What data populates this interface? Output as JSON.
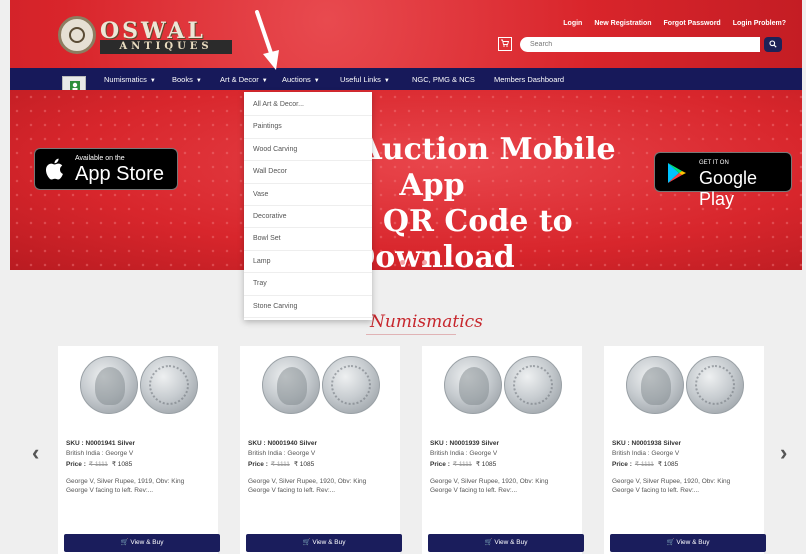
{
  "header": {
    "logo_line1": "OSWAL",
    "logo_line2": "ANTIQUES",
    "links": [
      "Login",
      "New Registration",
      "Forgot Password",
      "Login Problem?"
    ],
    "search_placeholder": "Search"
  },
  "nav": {
    "items": [
      "Numismatics",
      "Books",
      "Art & Decor",
      "Auctions",
      "Useful Links",
      "NGC, PMG & NCS",
      "Members Dashboard"
    ]
  },
  "dropdown": {
    "items": [
      "All Art & Decor...",
      "Paintings",
      "Wood Carving",
      "Wall Decor",
      "Vase",
      "Decorative",
      "Bowl Set",
      "Lamp",
      "Tray",
      "Stone Carving"
    ]
  },
  "hero": {
    "title_line1": "Oswal Auction Mobile App",
    "title_line2": "Scan QR Code to",
    "title_line3": "Download",
    "appstore_small": "Available on the",
    "appstore_big": "App Store",
    "play_small": "GET IT ON",
    "play_big": "Google Play"
  },
  "section": {
    "title": "Numismatics"
  },
  "cards": [
    {
      "sku": "SKU : N0001941",
      "metal": "Silver",
      "subtitle": "British India : George V",
      "price_label": "Price :",
      "old_price": "₹ 1111",
      "price": "₹ 1085",
      "desc1": "George V, Silver Rupee, 1919, Obv: King",
      "desc2": "George V facing to left. Rev:...",
      "button": "View & Buy"
    },
    {
      "sku": "SKU : N0001940",
      "metal": "Silver",
      "subtitle": "British India : George V",
      "price_label": "Price :",
      "old_price": "₹ 1111",
      "price": "₹ 1085",
      "desc1": "George V, Silver Rupee, 1920, Obv: King",
      "desc2": "George V facing to left. Rev:...",
      "button": "View & Buy"
    },
    {
      "sku": "SKU : N0001939",
      "metal": "Silver",
      "subtitle": "British India : George V",
      "price_label": "Price :",
      "old_price": "₹ 1111",
      "price": "₹ 1085",
      "desc1": "George V, Silver Rupee, 1920, Obv: King",
      "desc2": "George V facing to left. Rev:...",
      "button": "View & Buy"
    },
    {
      "sku": "SKU : N0001938",
      "metal": "Silver",
      "subtitle": "British India : George V",
      "price_label": "Price :",
      "old_price": "₹ 1111",
      "price": "₹ 1085",
      "desc1": "George V, Silver Rupee, 1920, Obv: King",
      "desc2": "George V facing to left. Rev:...",
      "button": "View & Buy"
    }
  ],
  "colors": {
    "header_red": "#d9252b",
    "nav_navy": "#17195a",
    "button_navy": "#1a1d5c",
    "heading_red": "#c7272d"
  }
}
